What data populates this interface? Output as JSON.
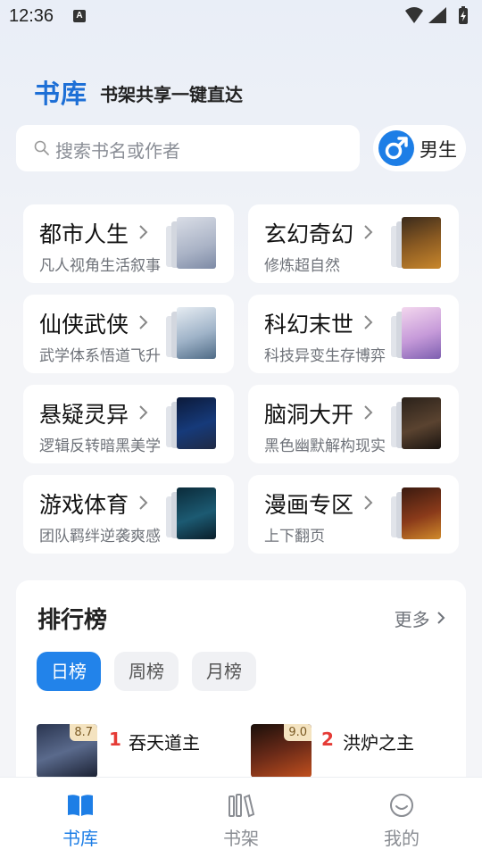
{
  "status_bar": {
    "time": "12:36",
    "badge": "A"
  },
  "header": {
    "title": "书库",
    "slogan": "书架共享一键直达"
  },
  "search": {
    "placeholder": "搜索书名或作者",
    "gender_label": "男生"
  },
  "categories": [
    {
      "title": "都市人生",
      "desc": "凡人视角生活叙事"
    },
    {
      "title": "玄幻奇幻",
      "desc": "修炼超自然"
    },
    {
      "title": "仙侠武侠",
      "desc": "武学体系悟道飞升"
    },
    {
      "title": "科幻末世",
      "desc": "科技异变生存博弈"
    },
    {
      "title": "悬疑灵异",
      "desc": "逻辑反转暗黑美学"
    },
    {
      "title": "脑洞大开",
      "desc": "黑色幽默解构现实"
    },
    {
      "title": "游戏体育",
      "desc": "团队羁绊逆袭爽感"
    },
    {
      "title": "漫画专区",
      "desc": "上下翻页"
    }
  ],
  "ranking": {
    "title": "排行榜",
    "more": "更多",
    "tabs": [
      "日榜",
      "周榜",
      "月榜"
    ],
    "active_tab": "日榜",
    "books": [
      {
        "rank": "1",
        "name": "吞天道主",
        "score": "8.7"
      },
      {
        "rank": "2",
        "name": "洪炉之主",
        "score": "9.0"
      }
    ]
  },
  "tabbar": {
    "items": [
      "书库",
      "书架",
      "我的"
    ],
    "active": "书库"
  },
  "colors": {
    "accent": "#1d7ee6",
    "rank_red": "#e53b36"
  }
}
